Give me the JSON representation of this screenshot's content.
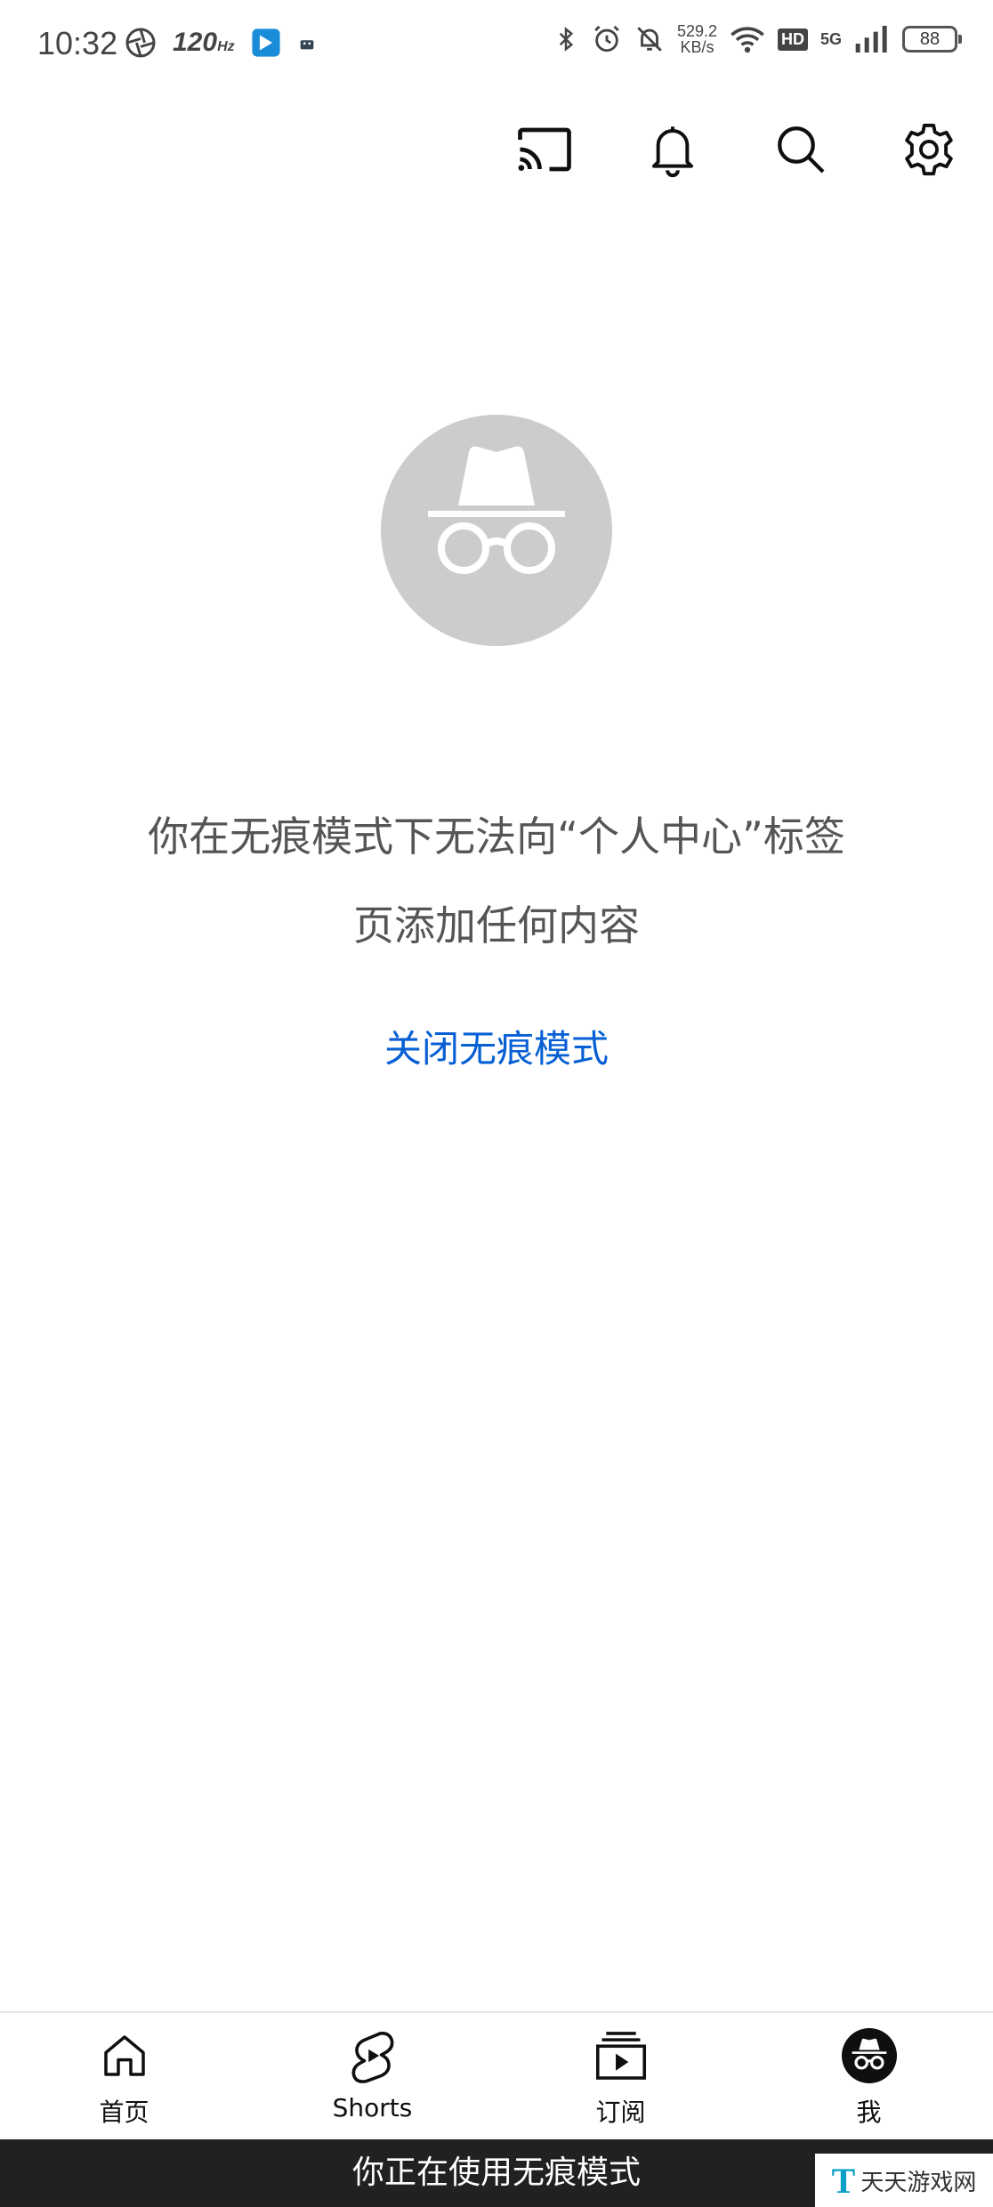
{
  "status_bar": {
    "time": "10:32",
    "refresh_rate": "120",
    "refresh_unit": "Hz",
    "net_speed": "529.2",
    "net_speed_unit": "KB/s",
    "hd": "HD",
    "network": "5G",
    "battery": "88"
  },
  "top_bar": {
    "icons": [
      "cast-icon",
      "notifications-bell-icon",
      "search-icon",
      "settings-gear-icon"
    ]
  },
  "main": {
    "message_line1": "你在无痕模式下无法向“个人中心”标签",
    "message_line2": "页添加任何内容",
    "turn_off_link": "关闭无痕模式"
  },
  "bottom_nav": {
    "items": [
      {
        "label": "首页",
        "icon": "home-icon"
      },
      {
        "label": "Shorts",
        "icon": "shorts-icon"
      },
      {
        "label": "订阅",
        "icon": "subscriptions-icon"
      },
      {
        "label": "我",
        "icon": "incognito-avatar-icon"
      }
    ]
  },
  "banner": {
    "text": "你正在使用无痕模式"
  },
  "watermark": {
    "logo": "T",
    "text": "天天游戏网"
  },
  "colors": {
    "link": "#065fd4",
    "banner_bg": "#212121",
    "avatar_bg": "#cccccc"
  }
}
